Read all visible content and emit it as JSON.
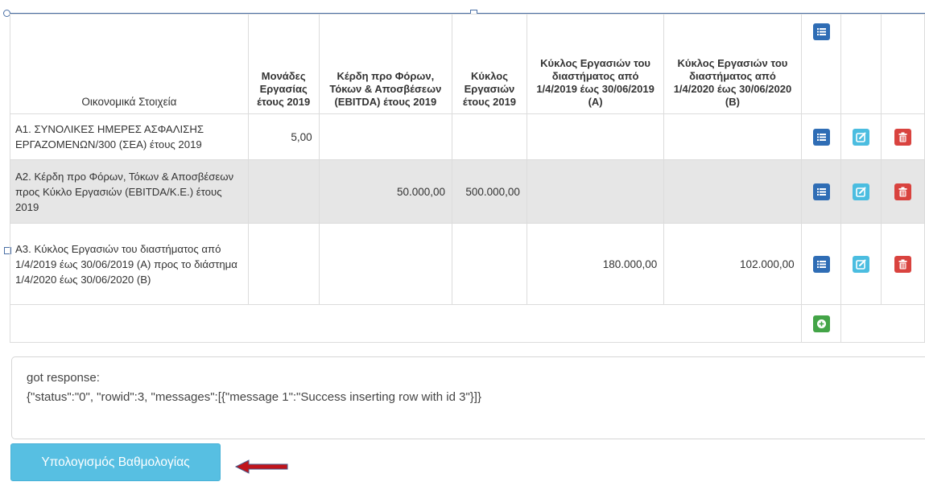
{
  "table": {
    "headers": [
      "Οικονομικά Στοιχεία",
      "Μονάδες Εργασίας έτους 2019",
      "Κέρδη προ Φόρων, Τόκων & Αποσβέσεων (EBITDA) έτους 2019",
      "Κύκλος Εργασιών έτους 2019",
      "Κύκλος Εργασιών του διαστήματος από 1/4/2019 έως 30/06/2019 (Α)",
      "Κύκλος Εργασιών του διαστήματος από 1/4/2020 έως 30/06/2020 (Β)"
    ],
    "rows": [
      {
        "label": "Α1. ΣΥΝΟΛΙΚΕΣ ΗΜΕΡΕΣ ΑΣΦΑΛΙΣΗΣ ΕΡΓΑΖΟΜΕΝΩΝ/300 (ΣΕΑ) έτους 2019",
        "units": "5,00",
        "ebitda": "",
        "turnover": "",
        "turnover_a": "",
        "turnover_b": ""
      },
      {
        "label": "Α2. Κέρδη προ Φόρων, Τόκων & Αποσβέσεων προς Κύκλο Εργασιών (EBITDA/Κ.Ε.) έτους 2019",
        "units": "",
        "ebitda": "50.000,00",
        "turnover": "500.000,00",
        "turnover_a": "",
        "turnover_b": ""
      },
      {
        "label": "Α3. Κύκλος Εργασιών του διαστήματος από 1/4/2019 έως 30/06/2019 (Α) προς το διάστημα 1/4/2020 έως 30/06/2020 (Β)",
        "units": "",
        "ebitda": "",
        "turnover": "",
        "turnover_a": "180.000,00",
        "turnover_b": "102.000,00"
      }
    ]
  },
  "response": {
    "line1": "got response:",
    "line2": "{\"status\":\"0\", \"rowid\":3, \"messages\":[{\"message 1\":\"Success inserting row with id 3\"}]}"
  },
  "calc_button_label": "Υπολογισμός Βαθμολογίας",
  "colors": {
    "details_button": "#2f6db5",
    "edit_button": "#4bbde0",
    "delete_button": "#d9433f",
    "add_button": "#43a447",
    "calc_button": "#57bfe2",
    "arrow": "#c0141b"
  },
  "icons": [
    "list-icon",
    "edit-icon",
    "trash-icon",
    "plus-circle-icon",
    "red-arrow-icon"
  ]
}
